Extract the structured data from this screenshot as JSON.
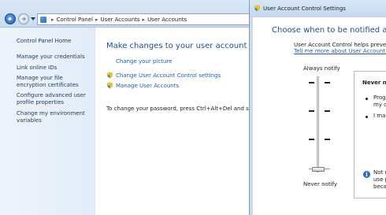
{
  "control_panel": {
    "breadcrumb": [
      "Control Panel",
      "User Accounts",
      "User Accounts"
    ],
    "sidebar": {
      "home": "Control Panel Home",
      "links": [
        "Manage your credentials",
        "Link online IDs",
        "Manage your file encryption certificates",
        "Configure advanced user profile properties",
        "Change my environment variables"
      ]
    },
    "main": {
      "title": "Make changes to your user account",
      "links": [
        "Change your picture",
        "Change User Account Control settings",
        "Manage User Accounts"
      ],
      "hint": "To change your password, press Ctrl+Alt+Del and select Ch"
    }
  },
  "uac_window": {
    "title": "User Account Control Settings",
    "heading": "Choose when to be notified a",
    "description": "User Account Control helps prevent po",
    "more_link": "Tell me more about User Account Con",
    "slider_top_label": "Always notify",
    "slider_bottom_label": "Never notify",
    "slider_level": "0 of 3 (bottom position)",
    "panel": {
      "title": "Never no",
      "bullet1_line1": "Progr",
      "bullet1_line2": "my co",
      "bullet2": "I make",
      "info_line1": "Not r",
      "info_line2": "use p",
      "info_line3": "beca"
    }
  },
  "colors": {
    "link": "#1e5fb3",
    "heading": "#1e4f8c",
    "sidebar_bg": "#e8f0fa"
  }
}
